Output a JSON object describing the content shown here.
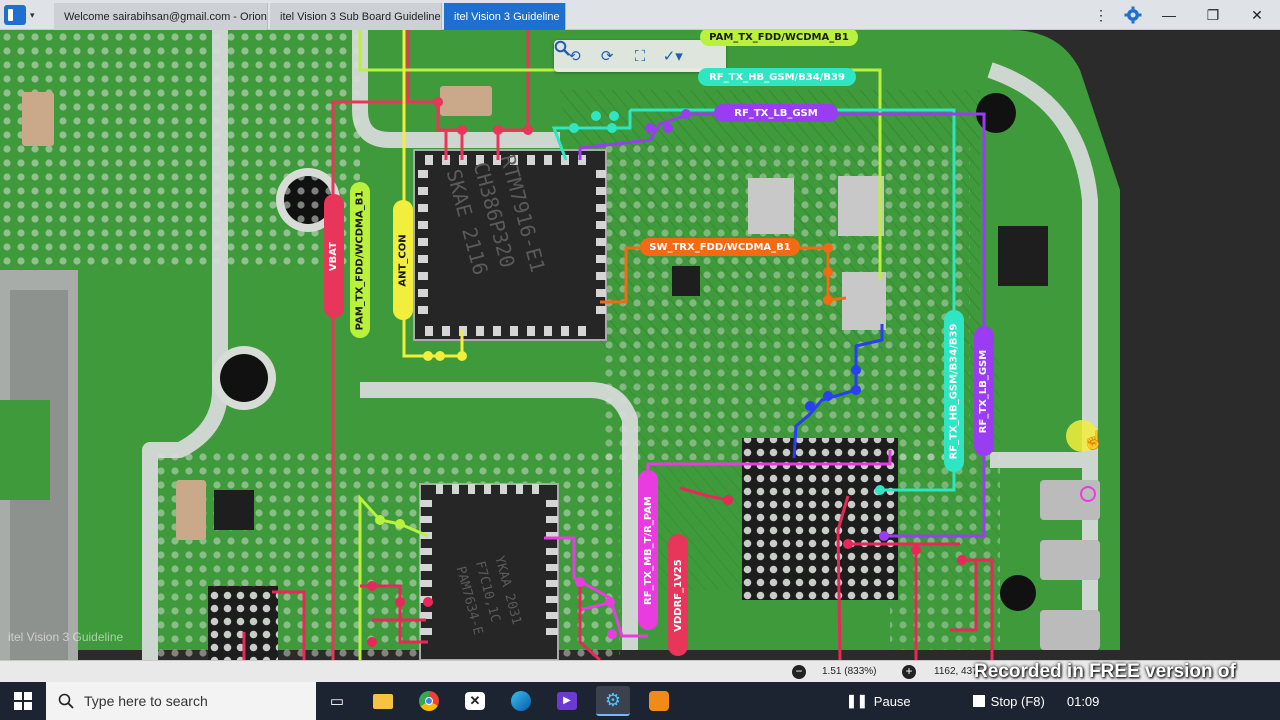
{
  "browser": {
    "tabs": [
      {
        "label": "Welcome sairabihsan@gmail.com - Orion"
      },
      {
        "label": "itel Vision 3 Sub Board Guideline"
      },
      {
        "label": "itel Vision 3 Guideline"
      }
    ],
    "active_tab_index": 2,
    "window_controls": {
      "minimize": "—",
      "restore": "❐",
      "close": "✕"
    },
    "menu_icon": "⋮"
  },
  "toolbar": {
    "icons": [
      "rotate-left-icon",
      "rotate-right-icon",
      "fit-icon",
      "highlight-tool-icon",
      "search-icon"
    ]
  },
  "board": {
    "document_watermark": "itel Vision 3 Guideline",
    "chip_marking": [
      "RTM7916-E1",
      "CH386P320",
      "SKAE 2116"
    ],
    "lower_chip_marking": [
      "YKAA 2031",
      "F7C10,1C",
      "PAM7634-E"
    ],
    "net_labels": {
      "pam_tx_fdd_top": "PAM_TX_FDD/WCDMA_B1",
      "rf_tx_hb_gsm_top": "RF_TX_HB_GSM/B34/B39",
      "rf_tx_lb_gsm_top": "RF_TX_LB_GSM",
      "sw_trx_fdd": "SW_TRX_FDD/WCDMA_B1",
      "vbat": "VBAT",
      "pam_tx_fdd_vertical": "PAM_TX_FDD/WCDMA_B1",
      "ant_con": "ANT_CON",
      "rf_tx_hb_gsm_vertical": "RF_TX_HB_GSM/B34/B39",
      "rf_tx_lb_gsm_vertical": "RF_TX_LB_GSM",
      "rf_tx_mb_t_r_pam": "RF_TX_MB_T/R_PAM",
      "vddrf_1v25": "VDDRF_1V25"
    },
    "colors": {
      "pcb": "#3e9a3a",
      "vbat": "#e8355a",
      "pam": "#b8f23c",
      "ant": "#f2ee3c",
      "hb": "#2fe6c4",
      "lb": "#9a3cf2",
      "sw": "#f26a14",
      "mb": "#e83ce0",
      "vddrf": "#e8355a"
    }
  },
  "status_bar": {
    "zoom_readout": "1.51 (833%)",
    "coordinate_readout": "1162, 437"
  },
  "recorder": {
    "overlay_text": "Recorded in FREE version of Icecream Screen Recorder",
    "pause_label": "Pause",
    "stop_label": "Stop (F8)",
    "timer": "01:09"
  },
  "taskbar": {
    "search_placeholder": "Type here to search",
    "apps": [
      "task-view-icon",
      "file-explorer-icon",
      "chrome-icon",
      "app-x-icon",
      "edge-icon",
      "media-icon",
      "board-viewer-icon",
      "orion-icon"
    ]
  }
}
